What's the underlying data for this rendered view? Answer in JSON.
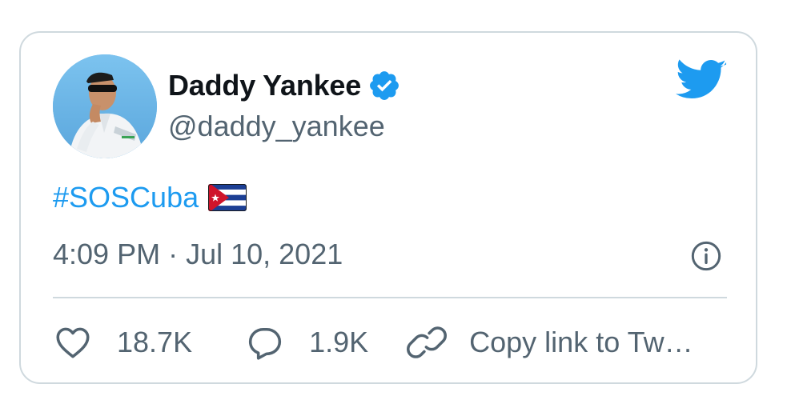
{
  "author": {
    "display_name": "Daddy Yankee",
    "handle": "@daddy_yankee",
    "verified": true,
    "avatar_icon": "profile-photo"
  },
  "tweet": {
    "hashtag": "#SOSCuba",
    "emoji": "cuba-flag",
    "time": "4:09 PM",
    "separator": "·",
    "date": "Jul 10, 2021"
  },
  "actions": {
    "likes": "18.7K",
    "replies": "1.9K",
    "copy_link_label": "Copy link to Tw…"
  },
  "colors": {
    "accent": "#1d9bf0",
    "text_primary": "#0f1419",
    "text_secondary": "#536471",
    "border": "#cfd9de"
  },
  "icons": {
    "brand": "twitter-bird-icon",
    "info": "info-icon",
    "like": "heart-icon",
    "reply": "speech-bubble-icon",
    "link": "link-icon"
  }
}
